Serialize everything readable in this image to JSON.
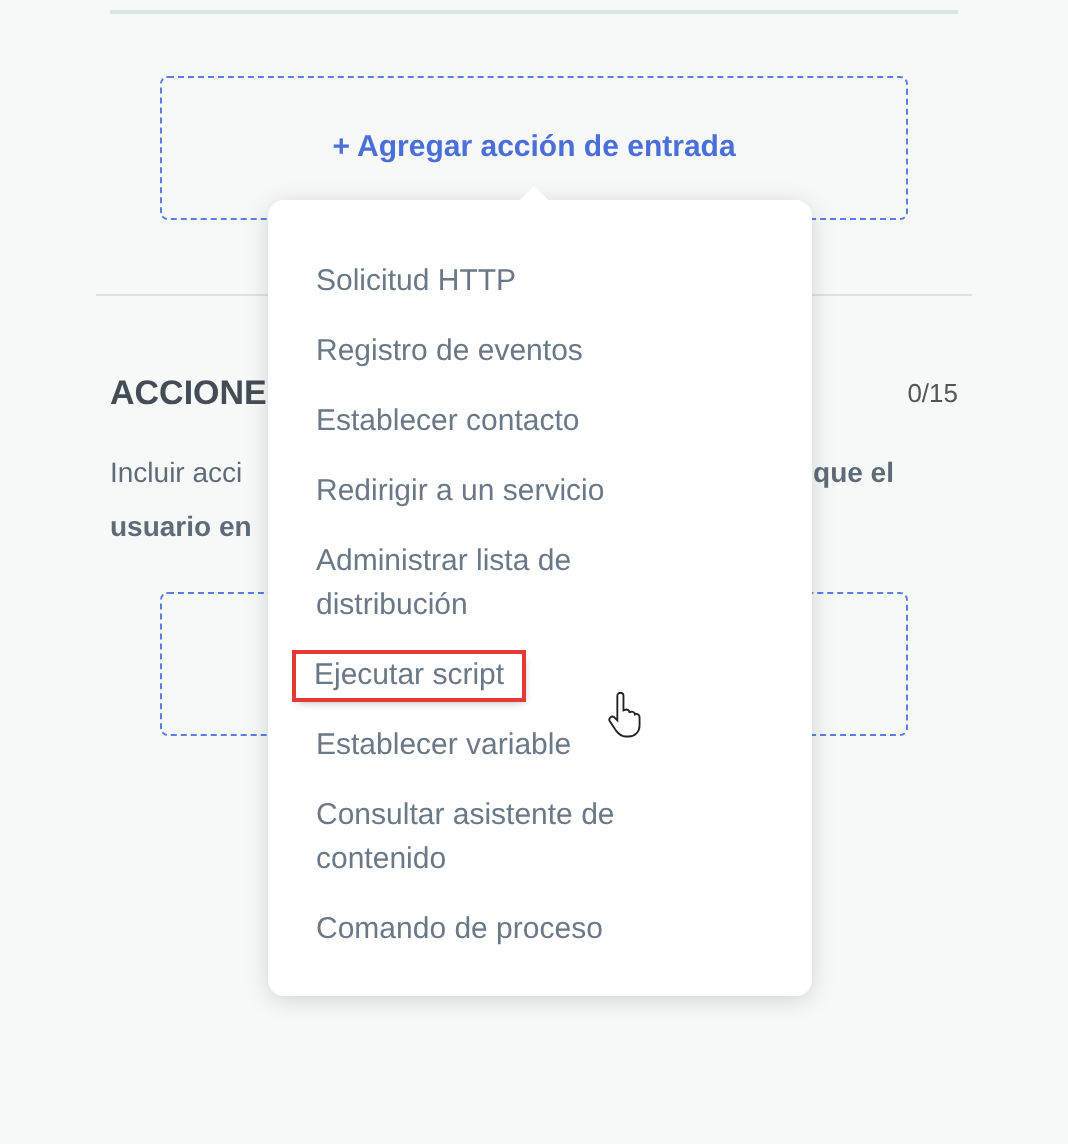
{
  "entry_action": {
    "label": "+ Agregar acción de entrada"
  },
  "actions_section": {
    "heading": "ACCIONE",
    "count": "0/15",
    "description_lines": [
      {
        "left": {
          "text": "Incluir acci",
          "bold": false
        },
        "right": {
          "text": "que el",
          "bold": true
        }
      },
      {
        "left": {
          "text": "usuario en",
          "bold": true
        }
      }
    ]
  },
  "menu": {
    "items": [
      {
        "label": "Solicitud HTTP",
        "selected": false
      },
      {
        "label": "Registro de eventos",
        "selected": false
      },
      {
        "label": "Establecer contacto",
        "selected": false
      },
      {
        "label": "Redirigir a un servicio",
        "selected": false
      },
      {
        "label": "Administrar lista de distribución",
        "selected": false
      },
      {
        "label": "Ejecutar script",
        "selected": true
      },
      {
        "label": "Establecer variable",
        "selected": false
      },
      {
        "label": "Consultar asistente de contenido",
        "selected": false
      },
      {
        "label": "Comando de proceso",
        "selected": false
      }
    ]
  }
}
